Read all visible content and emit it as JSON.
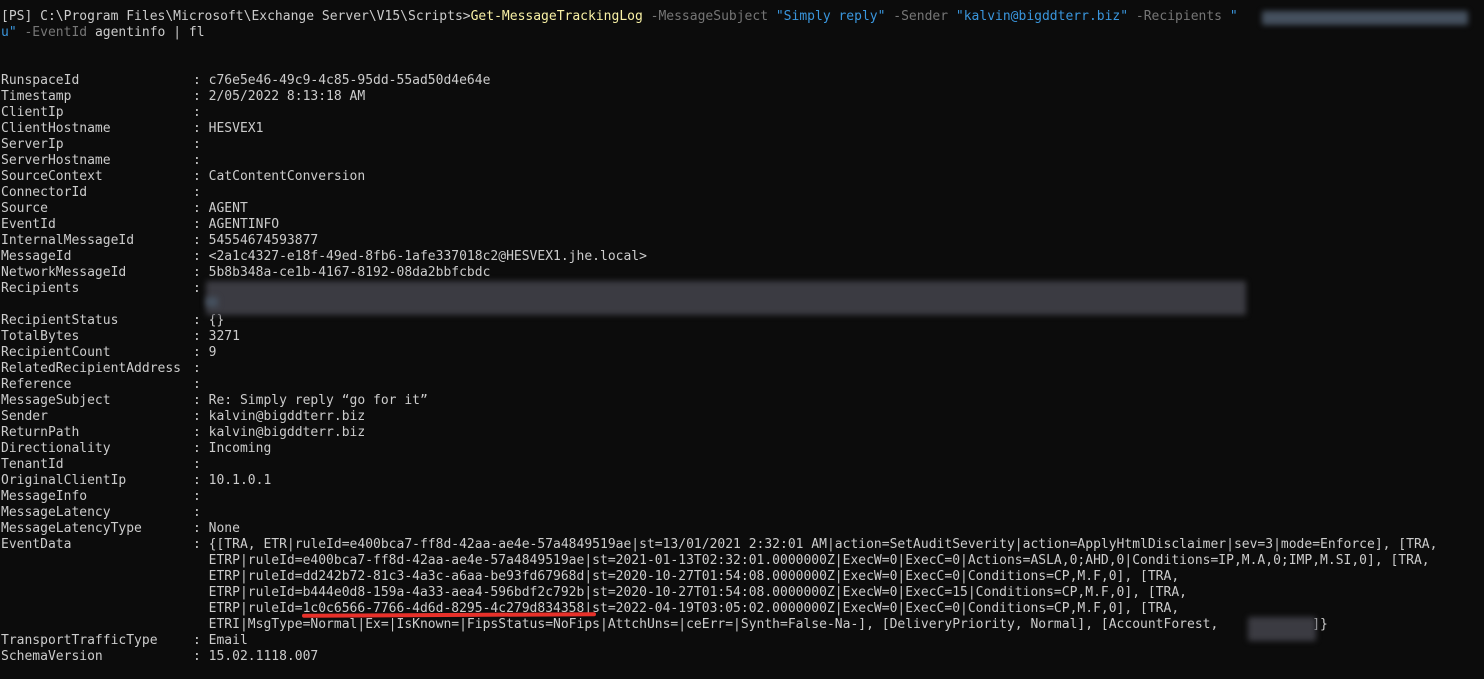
{
  "prompt": {
    "line1_prefix": "[PS] C:\\Program Files\\Microsoft\\Exchange Server\\V15\\Scripts>",
    "cmdlet": "Get-MessageTrackingLog",
    "p_subject": " -MessageSubject ",
    "v_subject": "\"Simply reply\"",
    "p_sender": " -Sender ",
    "v_sender": "\"kalvin@bigddterr.biz\"",
    "p_recipients": " -Recipients ",
    "v_recipients_open": "\"",
    "line2_start": "u\"",
    "p_eventid": " -EventId ",
    "v_eventid": "agentinfo",
    "pipe": " | fl"
  },
  "output": {
    "fields": [
      {
        "key": "RunspaceId",
        "value": "c76e5e46-49c9-4c85-95dd-55ad50d4e64e"
      },
      {
        "key": "Timestamp",
        "value": "2/05/2022 8:13:18 AM"
      },
      {
        "key": "ClientIp",
        "value": ""
      },
      {
        "key": "ClientHostname",
        "value": "HESVEX1"
      },
      {
        "key": "ServerIp",
        "value": ""
      },
      {
        "key": "ServerHostname",
        "value": ""
      },
      {
        "key": "SourceContext",
        "value": "CatContentConversion"
      },
      {
        "key": "ConnectorId",
        "value": ""
      },
      {
        "key": "Source",
        "value": "AGENT"
      },
      {
        "key": "EventId",
        "value": "AGENTINFO"
      },
      {
        "key": "InternalMessageId",
        "value": "54554674593877"
      },
      {
        "key": "MessageId",
        "value": "<2a1c4327-e18f-49ed-8fb6-1afe337018c2@HESVEX1.jhe.local>"
      },
      {
        "key": "NetworkMessageId",
        "value": "5b8b348a-ce1b-4167-8192-08da2bbfcbdc"
      },
      {
        "key": "Recipients",
        "value": ""
      },
      {
        "key": "",
        "value": ""
      },
      {
        "key": "RecipientStatus",
        "value": "{}"
      },
      {
        "key": "TotalBytes",
        "value": "3271"
      },
      {
        "key": "RecipientCount",
        "value": "9"
      },
      {
        "key": "RelatedRecipientAddress",
        "value": ""
      },
      {
        "key": "Reference",
        "value": ""
      },
      {
        "key": "MessageSubject",
        "value": "Re: Simply reply “go for it”"
      },
      {
        "key": "Sender",
        "value": "kalvin@bigddterr.biz"
      },
      {
        "key": "ReturnPath",
        "value": "kalvin@bigddterr.biz"
      },
      {
        "key": "Directionality",
        "value": "Incoming"
      },
      {
        "key": "TenantId",
        "value": ""
      },
      {
        "key": "OriginalClientIp",
        "value": "10.1.0.1"
      },
      {
        "key": "MessageInfo",
        "value": ""
      },
      {
        "key": "MessageLatency",
        "value": ""
      },
      {
        "key": "MessageLatencyType",
        "value": "None"
      },
      {
        "key": "EventData",
        "value": "{[TRA, ETR|ruleId=e400bca7-ff8d-42aa-ae4e-57a4849519ae|st=13/01/2021 2:32:01 AM|action=SetAuditSeverity|action=ApplyHtmlDisclaimer|sev=3|mode=Enforce], [TRA,"
      },
      {
        "key": "",
        "value": "ETRP|ruleId=e400bca7-ff8d-42aa-ae4e-57a4849519ae|st=2021-01-13T02:32:01.0000000Z|ExecW=0|ExecC=0|Actions=ASLA,0;AHD,0|Conditions=IP,M.A,0;IMP,M.SI,0], [TRA,"
      },
      {
        "key": "",
        "value": "ETRP|ruleId=dd242b72-81c3-4a3c-a6aa-be93fd67968d|st=2020-10-27T01:54:08.0000000Z|ExecW=0|ExecC=0|Conditions=CP,M.F,0], [TRA,"
      },
      {
        "key": "",
        "value": "ETRP|ruleId=b444e0d8-159a-4a33-aea4-596bdf2c792b|st=2020-10-27T01:54:08.0000000Z|ExecW=0|ExecC=15|Conditions=CP,M.F,0], [TRA,"
      },
      {
        "key": "",
        "value": "ETRP|ruleId=1c0c6566-7766-4d6d-8295-4c279d834358|st=2022-04-19T03:05:02.0000000Z|ExecW=0|ExecC=0|Conditions=CP,M.F,0], [TRA,"
      },
      {
        "key": "",
        "value": "ETRI|MsgType=Normal|Ex=|IsKnown=|FipsStatus=NoFips|AttchUns=|ceErr=|Synth=False-Na-], [DeliveryPriority, Normal], [AccountForest,           .]}"
      },
      {
        "key": "TransportTrafficType",
        "value": "Email"
      },
      {
        "key": "SchemaVersion",
        "value": "15.02.1118.007"
      }
    ]
  },
  "colors": {
    "background": "#0c0c0c",
    "foreground": "#cccccc",
    "cmdlet": "#f9f1a5",
    "parameter": "#767676",
    "string": "#3a96dd",
    "underline": "#e8312a"
  }
}
